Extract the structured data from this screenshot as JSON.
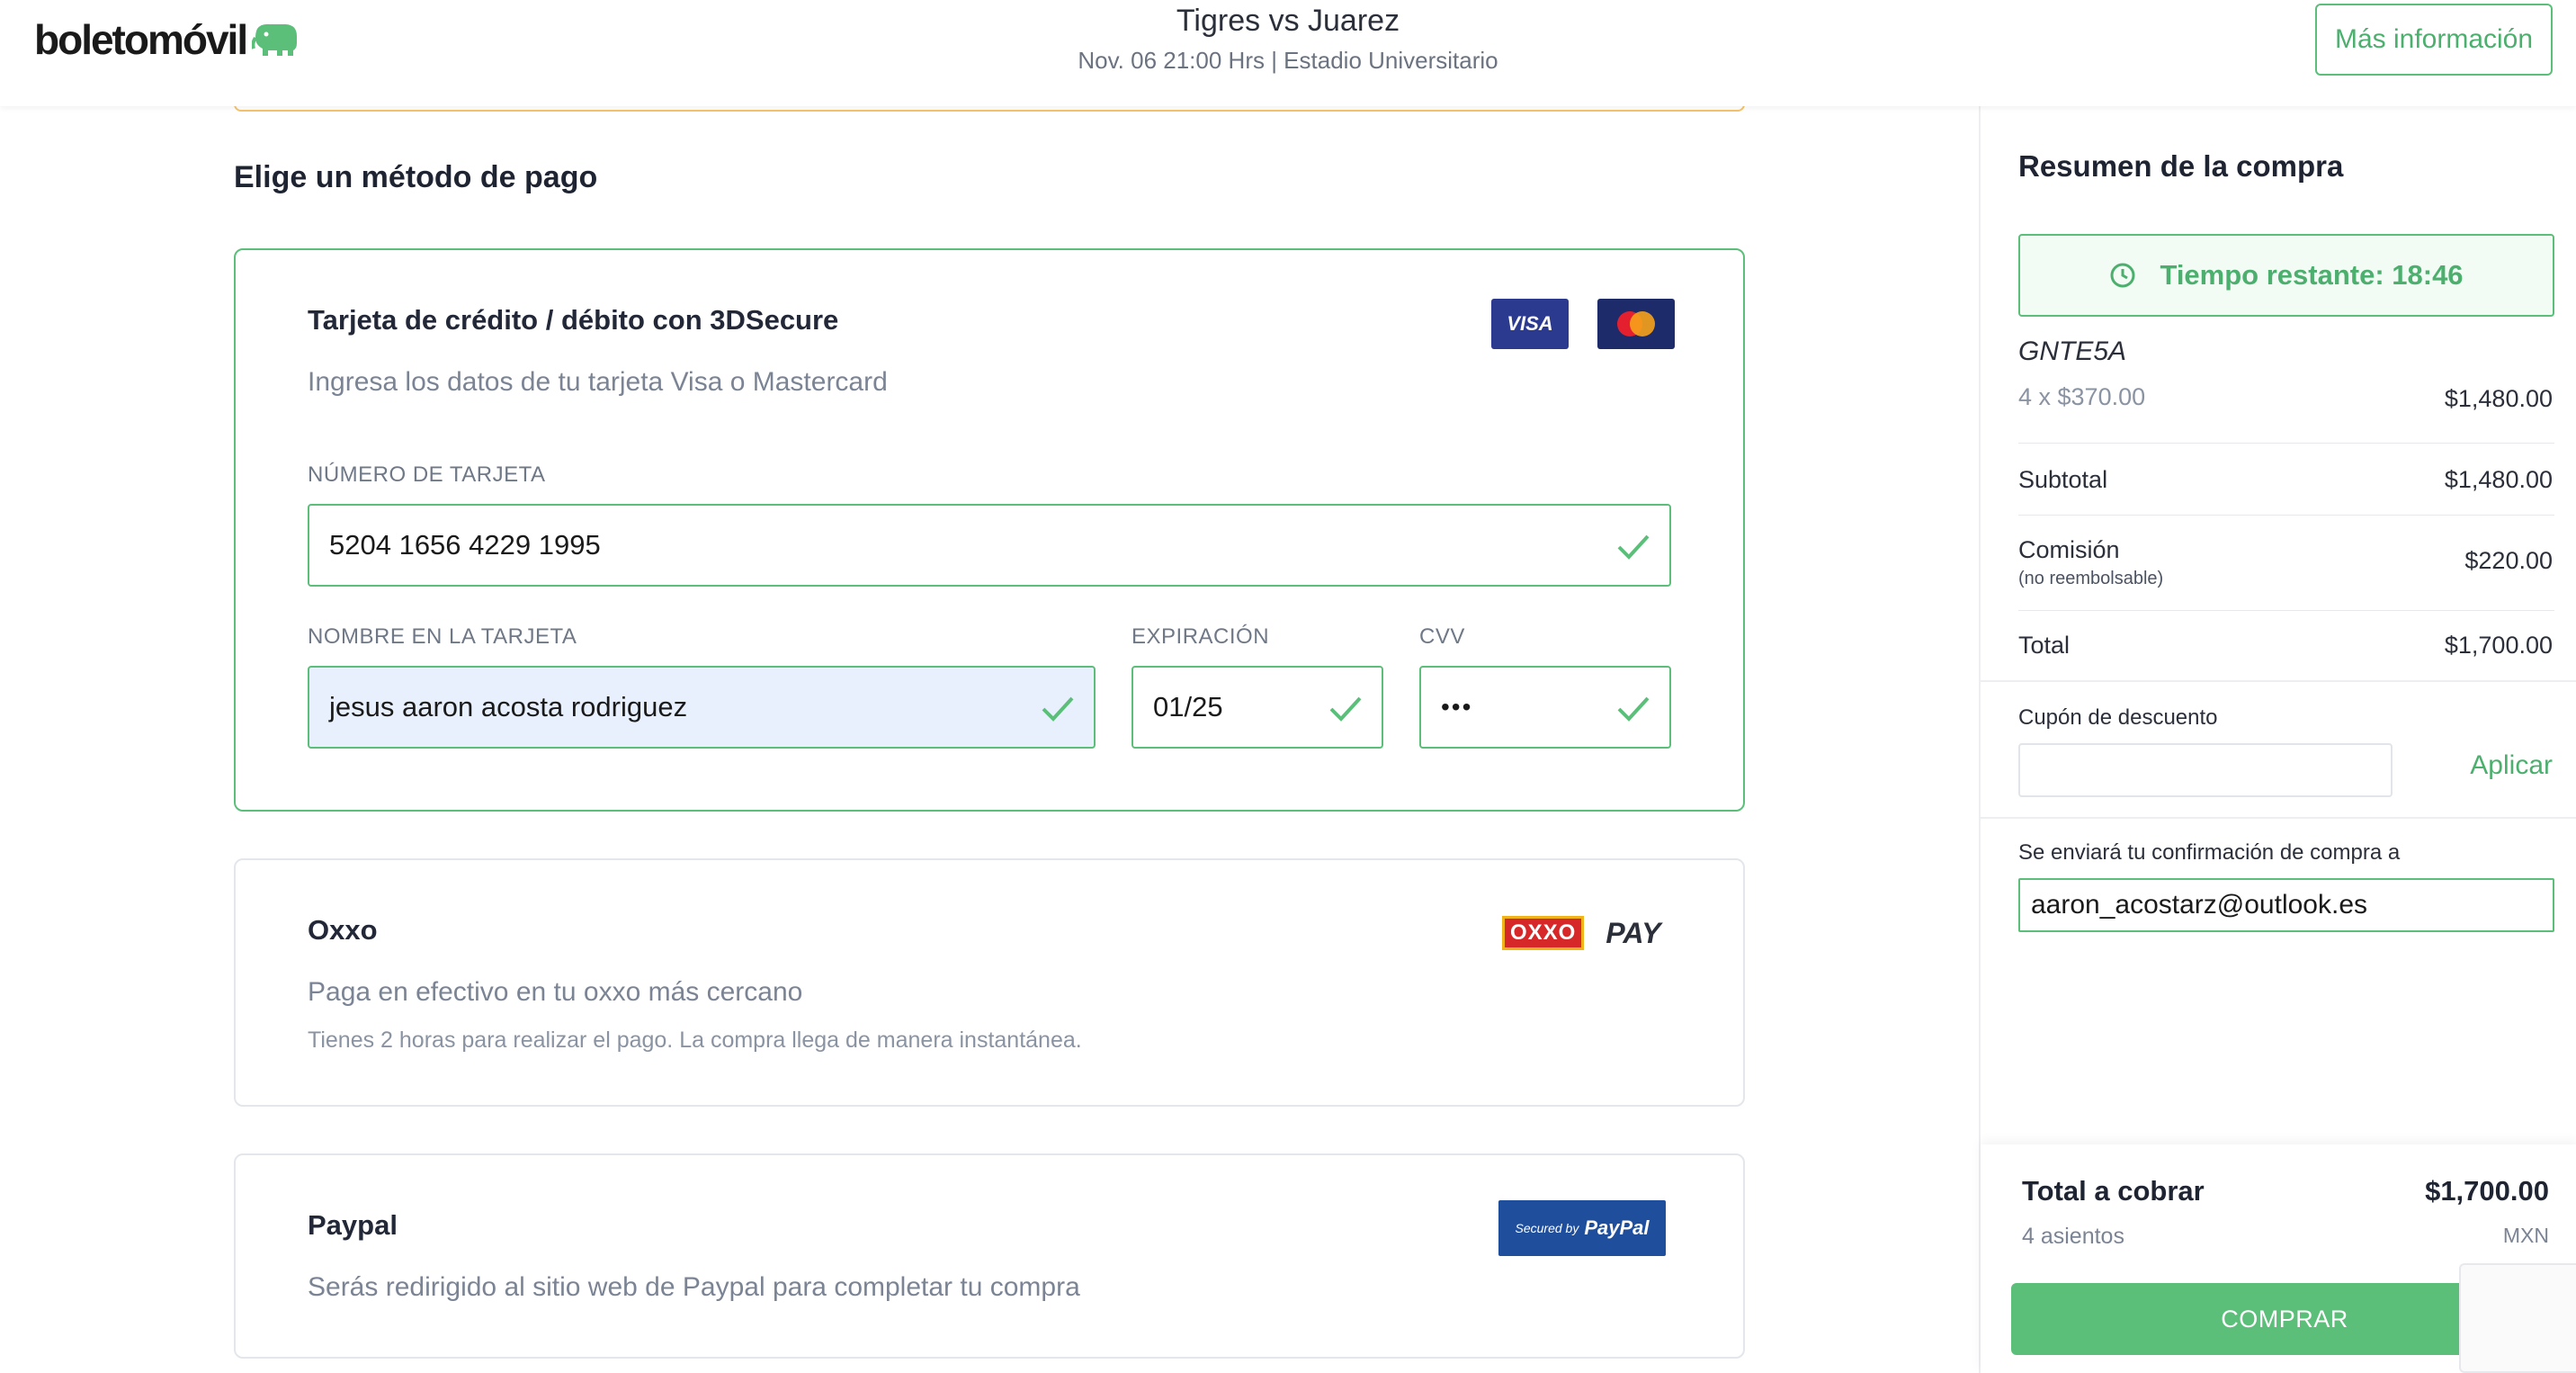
{
  "header": {
    "logo_text": "boletomóvil",
    "event_title": "Tigres vs Juarez",
    "event_subtitle": "Nov. 06 21:00 Hrs | Estadio Universitario",
    "more_info_label": "Más información"
  },
  "payment": {
    "section_title": "Elige un método de pago",
    "card": {
      "title": "Tarjeta de crédito / débito con 3DSecure",
      "description": "Ingresa los datos de tu tarjeta Visa o Mastercard",
      "visa_label": "VISA",
      "number_label": "NÚMERO DE TARJETA",
      "number_value": "5204 1656 4229 1995",
      "name_label": "NOMBRE EN LA TARJETA",
      "name_value": "jesus aaron acosta rodriguez",
      "expiration_label": "EXPIRACIÓN",
      "expiration_value": "01/25",
      "cvv_label": "CVV",
      "cvv_value": "•••"
    },
    "oxxo": {
      "title": "Oxxo",
      "description": "Paga en efectivo en tu oxxo más cercano",
      "note": "Tienes 2 horas para realizar el pago. La compra llega de manera instantánea.",
      "logo_left": "OXXO",
      "logo_right": "PAY"
    },
    "paypal": {
      "title": "Paypal",
      "description": "Serás redirigido al sitio web de Paypal para completar tu compra",
      "badge_prefix": "Secured by",
      "badge_brand": "PayPal"
    }
  },
  "summary": {
    "title": "Resumen de la compra",
    "timer_text": "Tiempo restante: 18:46",
    "zone": "GNTE5A",
    "line_qty": "4 x $370.00",
    "line_amount": "$1,480.00",
    "subtotal_label": "Subtotal",
    "subtotal_value": "$1,480.00",
    "fee_label": "Comisión",
    "fee_note": "(no reembolsable)",
    "fee_value": "$220.00",
    "total_label": "Total",
    "total_value": "$1,700.00",
    "coupon_label": "Cupón de descuento",
    "coupon_value": "",
    "apply_label": "Aplicar",
    "confirm_label": "Se enviará tu confirmación de compra a",
    "email_value": "aaron_acostarz@outlook.es",
    "charge_label": "Total a cobrar",
    "charge_value": "$1,700.00",
    "seats": "4 asientos",
    "currency": "MXN",
    "buy_label": "COMPRAR"
  },
  "colors": {
    "accent_green": "#5bbf7a",
    "warning_orange": "#f4c36b",
    "visa_blue": "#2b3a8f",
    "paypal_blue": "#1e4e9c",
    "oxxo_red": "#d62828"
  }
}
